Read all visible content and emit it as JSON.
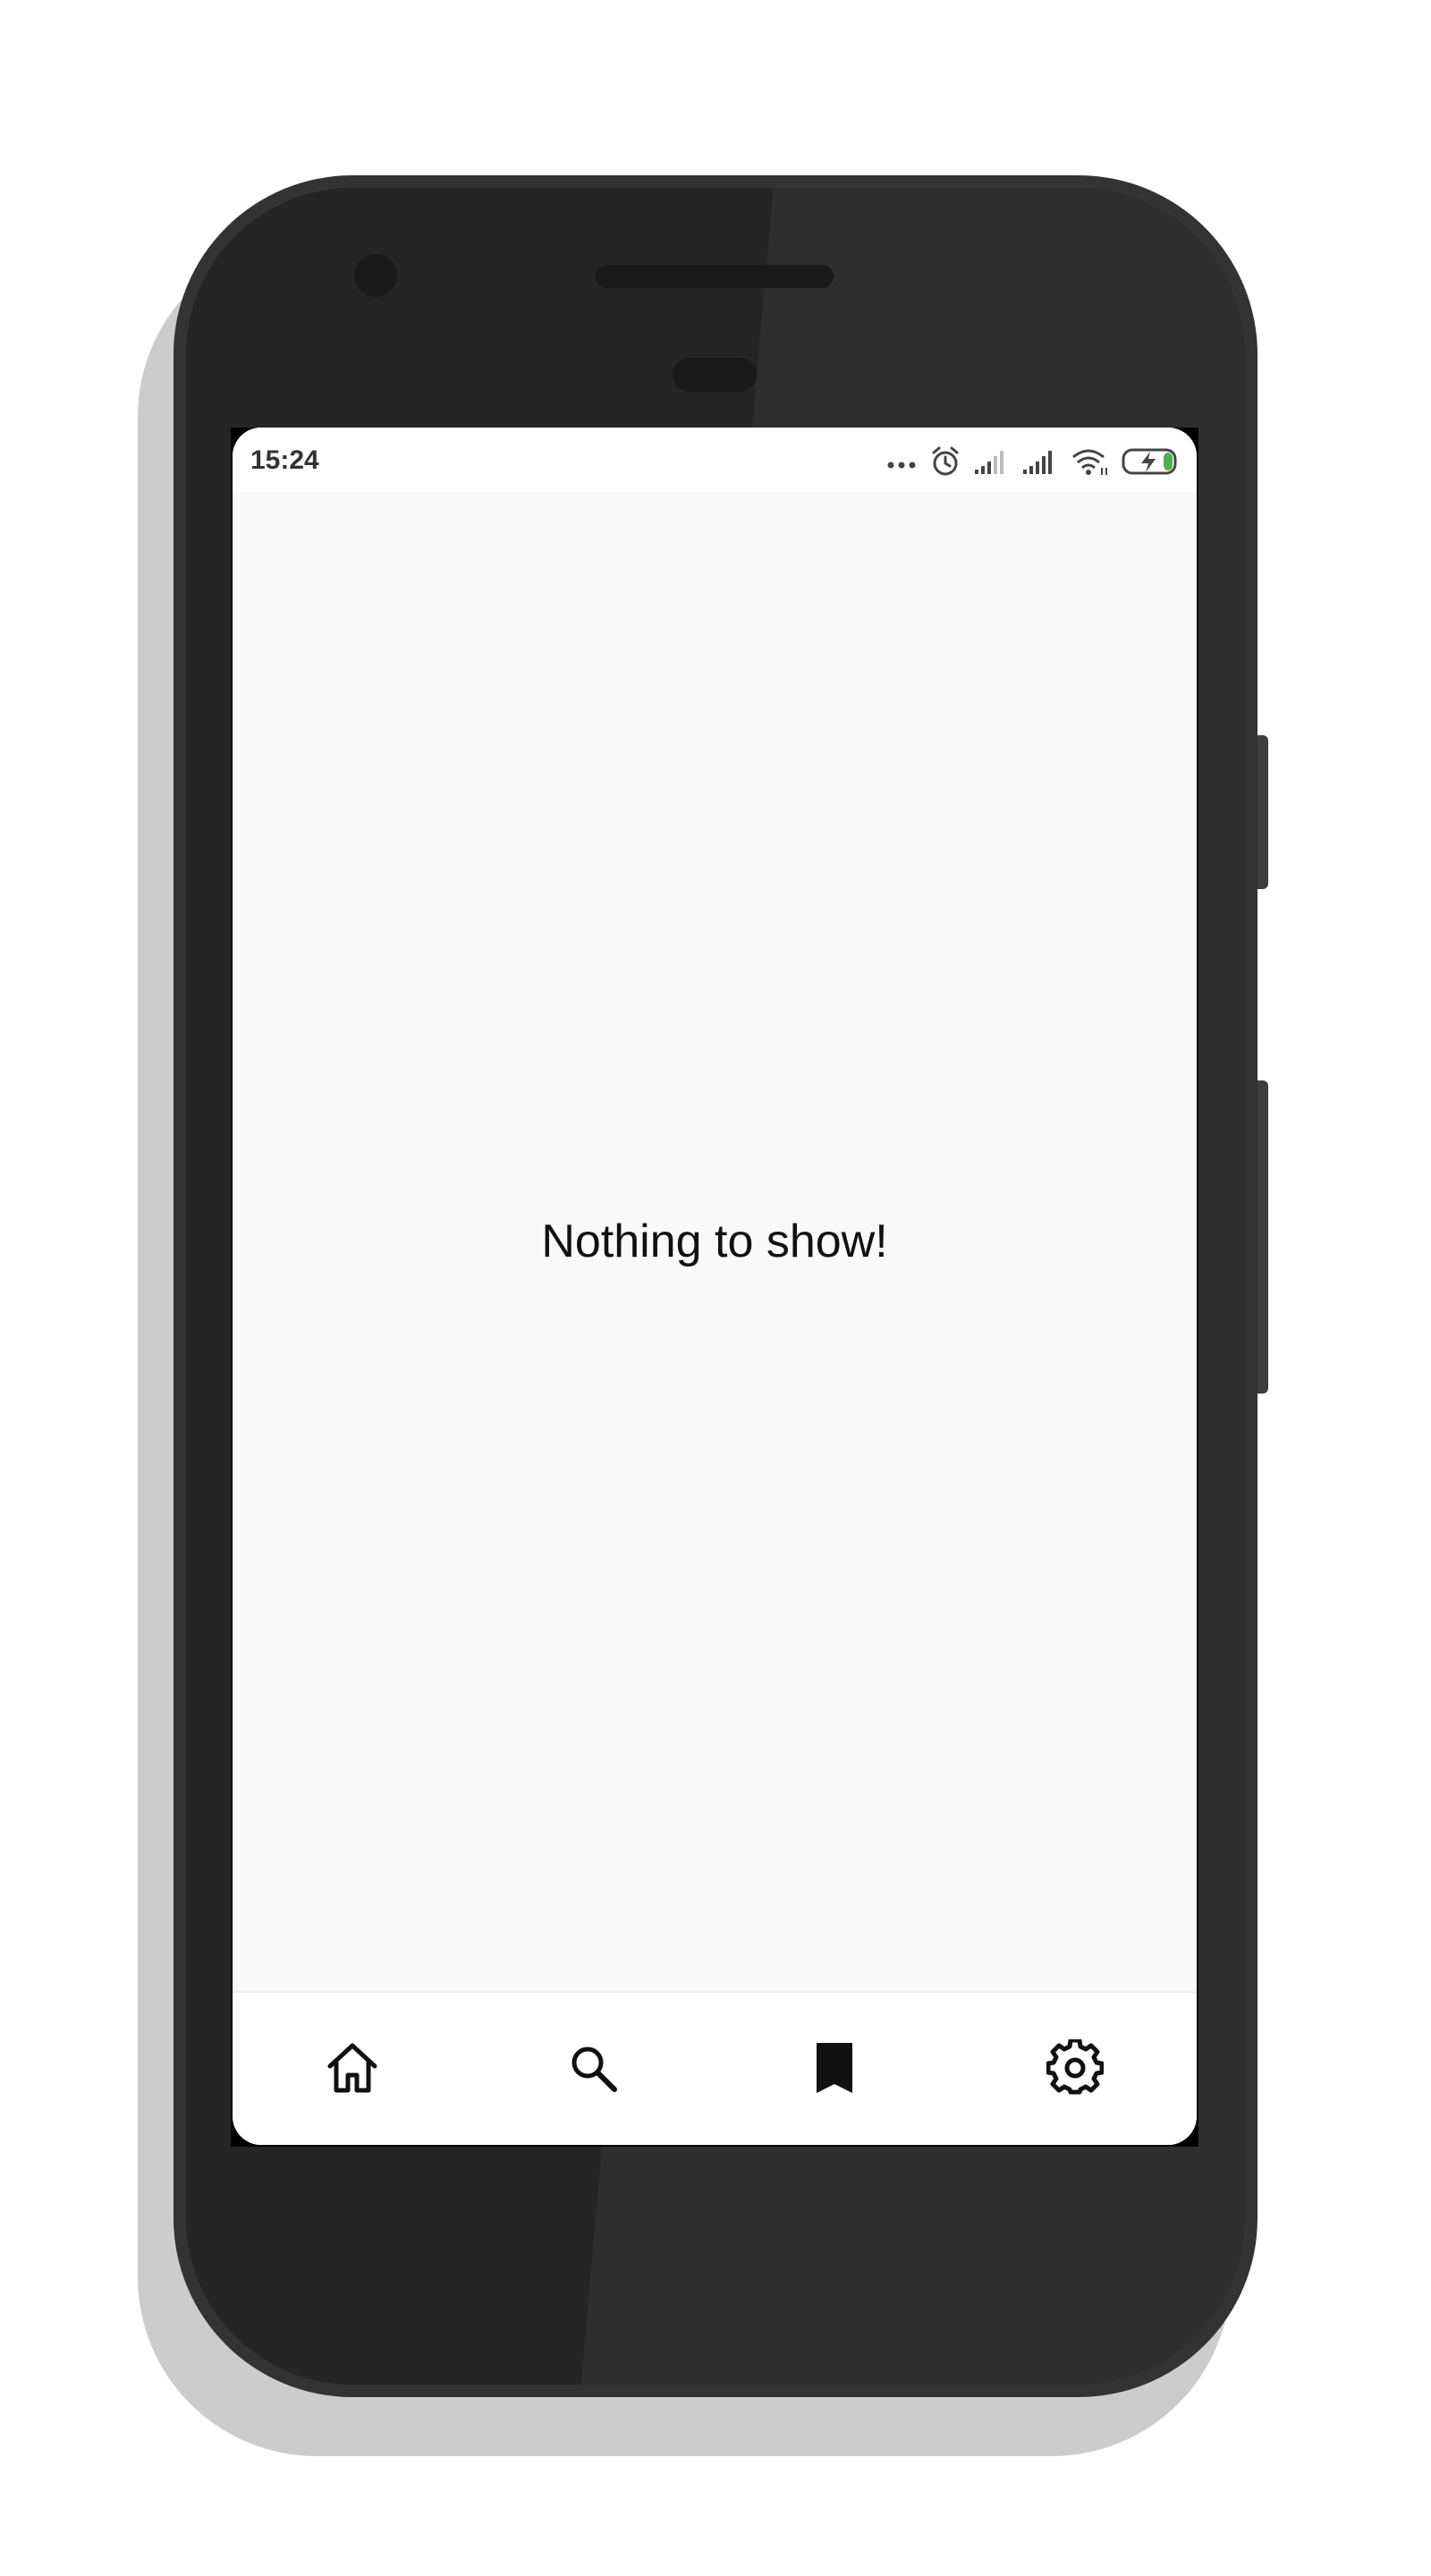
{
  "status_bar": {
    "time": "15:24",
    "icons": [
      "more-dots-icon",
      "alarm-icon",
      "signal-weak-icon",
      "signal-icon",
      "wifi-icon",
      "battery-charging-icon"
    ]
  },
  "content": {
    "empty_message": "Nothing to show!"
  },
  "bottom_nav": {
    "items": [
      {
        "icon": "home-icon"
      },
      {
        "icon": "search-icon"
      },
      {
        "icon": "bookmark-icon"
      },
      {
        "icon": "settings-gear-icon"
      }
    ]
  },
  "colors": {
    "device_body": "#333333",
    "screen_background": "#f9f9f9",
    "battery_charge": "#4caf50"
  }
}
